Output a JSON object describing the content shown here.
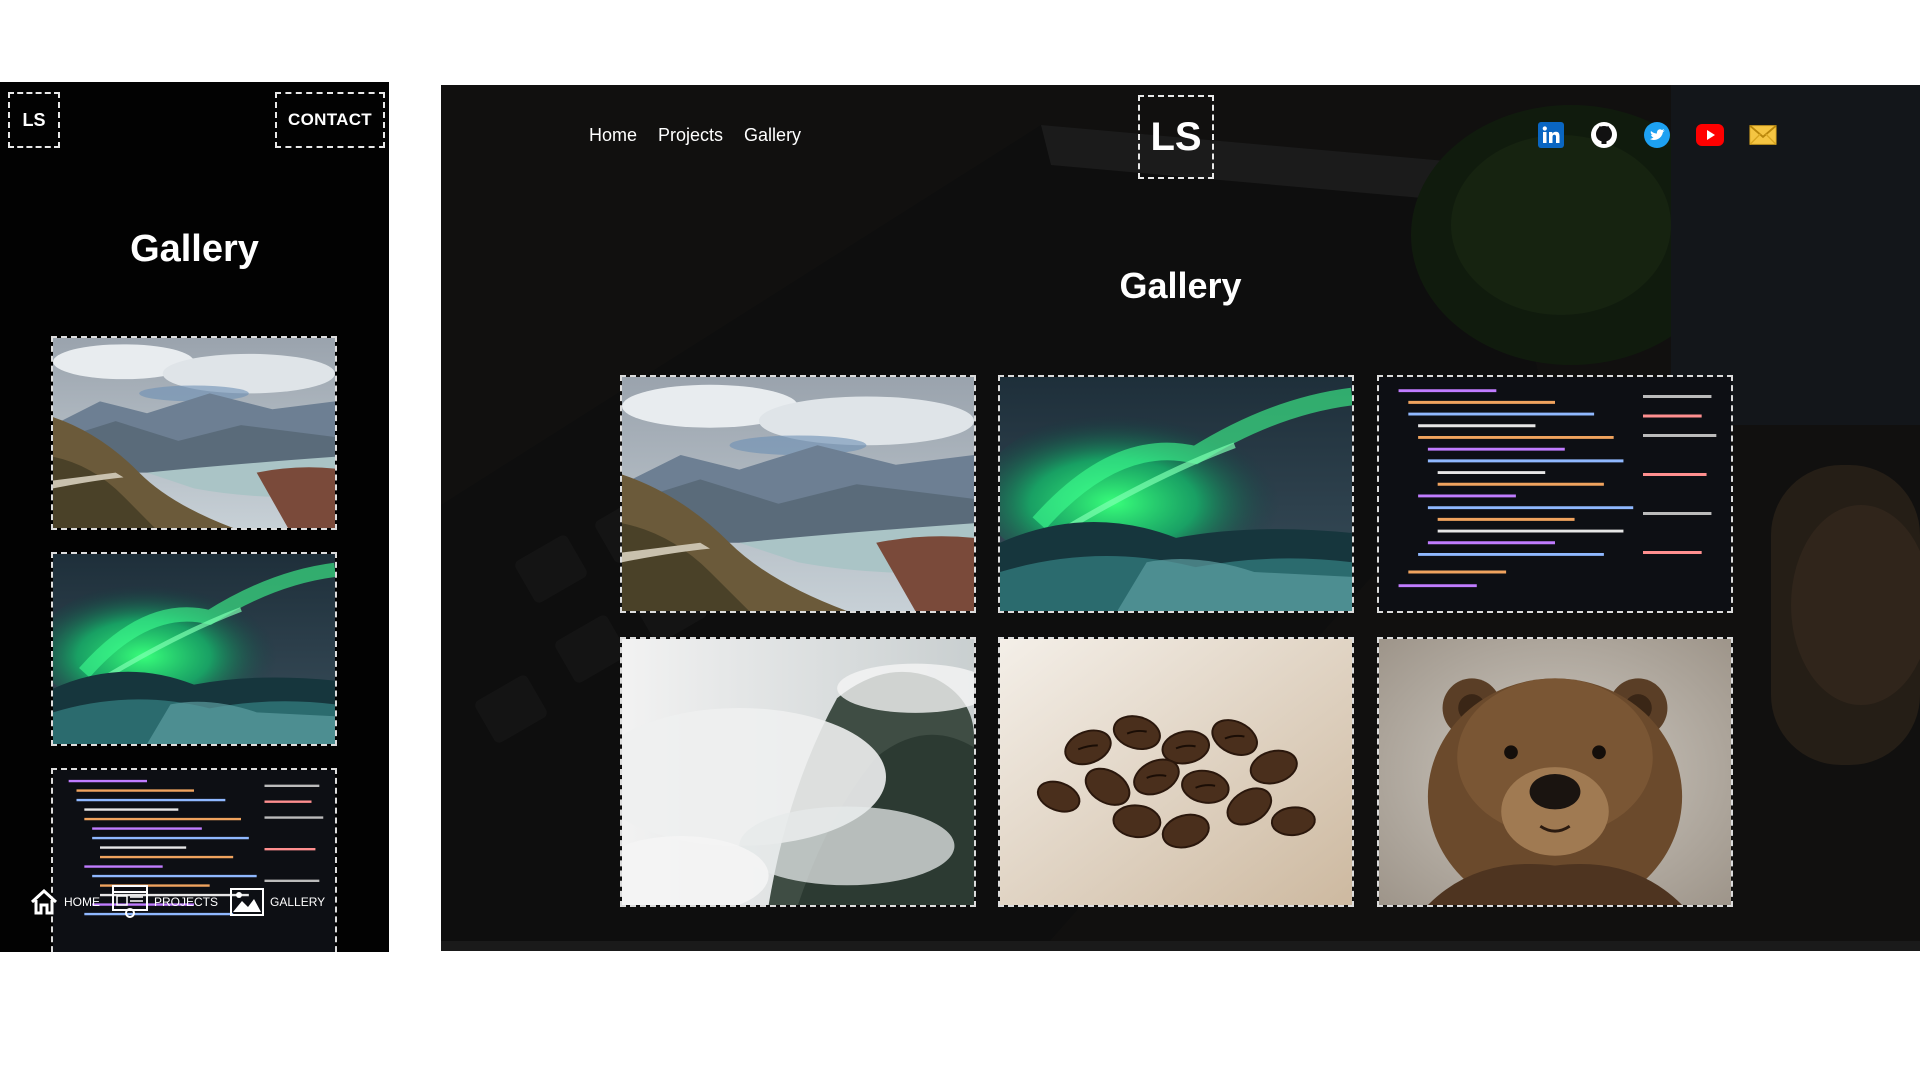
{
  "mobile": {
    "logo": "LS",
    "contact_label": "CONTACT",
    "title": "Gallery",
    "bottom_nav": [
      {
        "label": "HOME",
        "icon": "home-icon"
      },
      {
        "label": "PROJECTS",
        "icon": "projects-icon"
      },
      {
        "label": "GALLERY",
        "icon": "gallery-icon"
      }
    ]
  },
  "desktop": {
    "nav": [
      {
        "label": "Home"
      },
      {
        "label": "Projects"
      },
      {
        "label": "Gallery"
      }
    ],
    "logo": "LS",
    "title": "Gallery",
    "social": [
      {
        "icon": "linkedin-icon",
        "color": "#0a66c2"
      },
      {
        "icon": "github-icon",
        "color": "#ffffff"
      },
      {
        "icon": "twitter-icon",
        "color": "#1da1f2"
      },
      {
        "icon": "youtube-icon",
        "color": "#ff0000"
      },
      {
        "icon": "mail-icon",
        "color": "#f5c542"
      }
    ]
  },
  "gallery": [
    {
      "subject": "mountain-lake"
    },
    {
      "subject": "aurora"
    },
    {
      "subject": "code"
    },
    {
      "subject": "misty-forest"
    },
    {
      "subject": "coffee-beans"
    },
    {
      "subject": "bear"
    }
  ]
}
